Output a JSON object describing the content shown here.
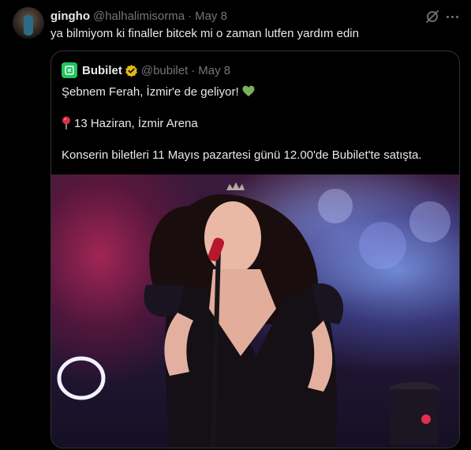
{
  "tweet": {
    "display_name": "gingho",
    "handle": "@halhalimisorma",
    "separator": "·",
    "date": "May 8",
    "text": "ya bilmiyom ki finaller bitcek mi o zaman lutfen yardım edin"
  },
  "quoted": {
    "display_name": "Bubilet",
    "handle": "@bubilet",
    "separator": "·",
    "date": "May 8",
    "line1": "Şebnem Ferah, İzmir'e de geliyor!",
    "line2": "13 Haziran, İzmir Arena",
    "line3": "Konserin biletleri 11 Mayıs pazartesi günü 12.00'de Bubilet'te satışta."
  },
  "colors": {
    "background": "#000000",
    "text": "#e7e9ea",
    "muted": "#71767b",
    "border": "#2f3336",
    "verified": "#e2b719",
    "brand": "#22c55e"
  },
  "icons": [
    "grok-icon",
    "more-icon",
    "verified-badge-icon",
    "green-heart-icon",
    "round-pushpin-icon",
    "bubilet-logo-icon"
  ]
}
